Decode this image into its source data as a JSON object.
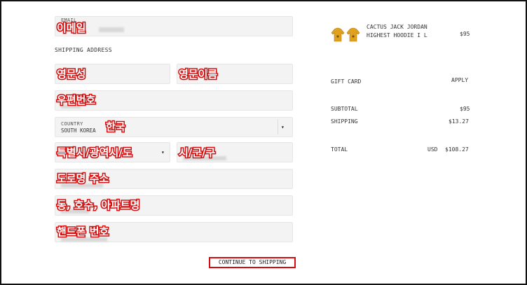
{
  "form": {
    "email": {
      "label": "EMAIL",
      "annotation": "이메일"
    },
    "shipping_heading": "SHIPPING ADDRESS",
    "first_name": {
      "annotation": "영문성"
    },
    "last_name": {
      "annotation": "영문이름"
    },
    "postcode": {
      "annotation": "우편번호"
    },
    "country": {
      "label": "COUNTRY",
      "value": "SOUTH KOREA",
      "annotation": "한국"
    },
    "province": {
      "annotation": "특별시/광역시/도"
    },
    "city": {
      "annotation": "시/군/구"
    },
    "address1": {
      "annotation": "도로명 주소"
    },
    "address2": {
      "annotation": "동, 호수, 아파트명"
    },
    "phone": {
      "annotation": "핸드폰 번호"
    },
    "continue_label": "CONTINUE TO SHIPPING"
  },
  "summary": {
    "product_name": "CACTUS JACK JORDAN HIGHEST HOODIE I L",
    "product_price": "$95",
    "gift_card_label": "GIFT CARD",
    "apply_label": "APPLY",
    "subtotal_label": "SUBTOTAL",
    "subtotal_value": "$95",
    "shipping_label": "SHIPPING",
    "shipping_value": "$13.27",
    "total_label": "TOTAL",
    "currency": "USD",
    "total_value": "$108.27"
  },
  "colors": {
    "annotation": "#d40e0e",
    "hoodie": "#e0a21e"
  }
}
